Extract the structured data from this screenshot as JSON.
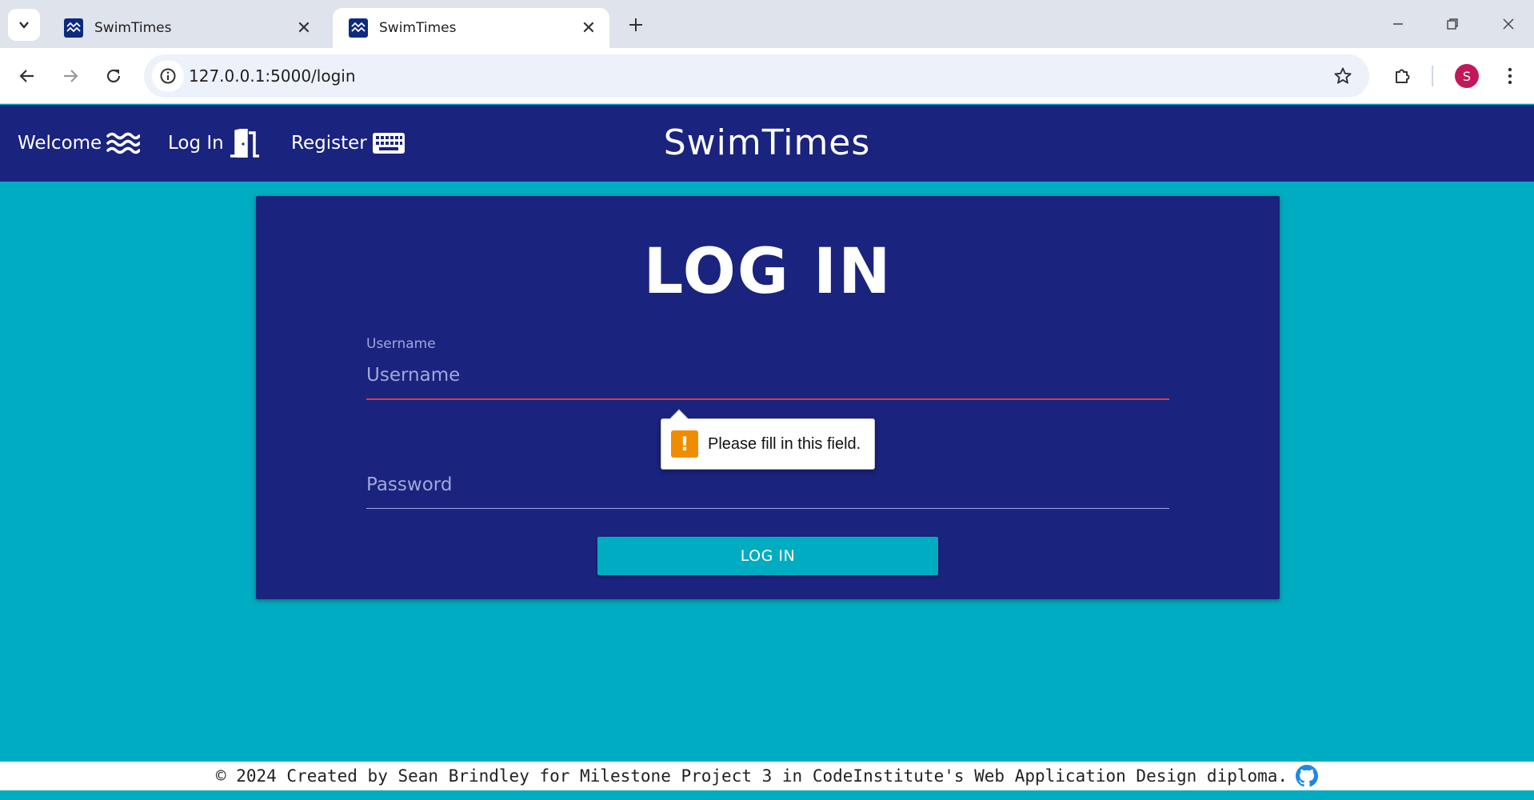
{
  "browser": {
    "tabs": [
      {
        "title": "SwimTimes",
        "active": false
      },
      {
        "title": "SwimTimes",
        "active": true
      }
    ],
    "url": "127.0.0.1:5000/login",
    "profile_initial": "S"
  },
  "nav": {
    "links": [
      {
        "label": "Welcome",
        "icon": "water-icon"
      },
      {
        "label": "Log In",
        "icon": "door-icon"
      },
      {
        "label": "Register",
        "icon": "keyboard-icon"
      }
    ],
    "brand": "SwimTimes"
  },
  "login": {
    "title": "LOG IN",
    "username_label": "Username",
    "username_placeholder": "Username",
    "password_placeholder": "Password",
    "validation_message": "Please fill in this field.",
    "submit_label": "LOG IN"
  },
  "footer": {
    "text": "© 2024 Created by Sean Brindley for Milestone Project 3 in CodeInstitute's Web Application Design diploma.",
    "icon": "github-icon"
  },
  "colors": {
    "nav_bg": "#1a237e",
    "page_bg": "#00acc1",
    "error_underline": "#e53935",
    "warning": "#f08c00"
  }
}
